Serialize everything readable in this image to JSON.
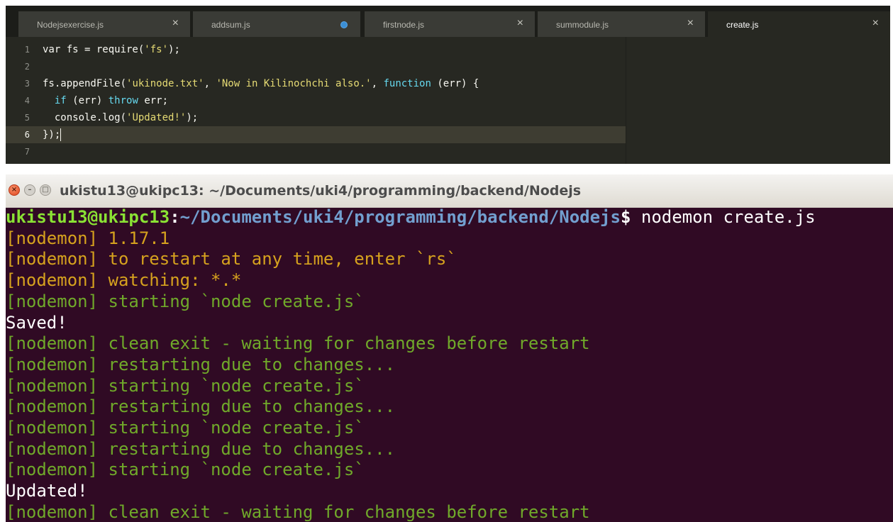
{
  "editor": {
    "tabs": [
      {
        "label": "Nodejsexercise.js",
        "state": "close"
      },
      {
        "label": "addsum.js",
        "state": "modified"
      },
      {
        "label": "firstnode.js",
        "state": "close"
      },
      {
        "label": "summodule.js",
        "state": "close"
      },
      {
        "label": "create.js",
        "state": "close",
        "active": true
      }
    ],
    "close_glyph": "×",
    "line_numbers": [
      "1",
      "2",
      "3",
      "4",
      "5",
      "6",
      "7"
    ],
    "current_line": 6,
    "code": {
      "l1": {
        "a": "var fs = require(",
        "b": "'fs'",
        "c": ");"
      },
      "l3": {
        "a": "fs.appendFile(",
        "b": "'ukinode.txt'",
        "c": ", ",
        "d": "'Now in Kilinochchi also.'",
        "e": ", ",
        "f": "function",
        "g": " (err) {"
      },
      "l4": {
        "a": "  ",
        "b": "if",
        "c": " (err) ",
        "d": "throw",
        "e": " err;"
      },
      "l5": {
        "a": "  console.log(",
        "b": "'Updated!'",
        "c": ");"
      },
      "l6": {
        "a": "});"
      }
    },
    "colors": {
      "keyword": "#66d9ef",
      "string": "#e6db74",
      "background": "#272822"
    }
  },
  "terminal": {
    "title": "ukistu13@ukipc13: ~/Documents/uki4/programming/backend/Nodejs",
    "prompt": {
      "user": "ukistu13@ukipc13",
      "sep": ":",
      "path": "~/Documents/uki4/programming/backend/Nodejs",
      "dollar": "$ ",
      "command": "nodemon create.js"
    },
    "lines": [
      {
        "text": "[nodemon] 1.17.1",
        "color": "yellow"
      },
      {
        "text": "[nodemon] to restart at any time, enter `rs`",
        "color": "yellow"
      },
      {
        "text": "[nodemon] watching: *.*",
        "color": "yellow"
      },
      {
        "text": "[nodemon] starting `node create.js`",
        "color": "green"
      },
      {
        "text": "Saved!",
        "color": "white"
      },
      {
        "text": "[nodemon] clean exit - waiting for changes before restart",
        "color": "green"
      },
      {
        "text": "[nodemon] restarting due to changes...",
        "color": "green"
      },
      {
        "text": "[nodemon] starting `node create.js`",
        "color": "green"
      },
      {
        "text": "[nodemon] restarting due to changes...",
        "color": "green"
      },
      {
        "text": "[nodemon] starting `node create.js`",
        "color": "green"
      },
      {
        "text": "[nodemon] restarting due to changes...",
        "color": "green"
      },
      {
        "text": "[nodemon] starting `node create.js`",
        "color": "green"
      },
      {
        "text": "Updated!",
        "color": "white"
      },
      {
        "text": "[nodemon] clean exit - waiting for changes before restart",
        "color": "green"
      }
    ],
    "window_buttons": {
      "close": "×",
      "minimize": "–",
      "maximize": "□"
    },
    "colors": {
      "background": "#300a24",
      "yellow": "#d6a21e",
      "green": "#70a92a",
      "user": "#8ae234",
      "path": "#729fcf"
    }
  }
}
